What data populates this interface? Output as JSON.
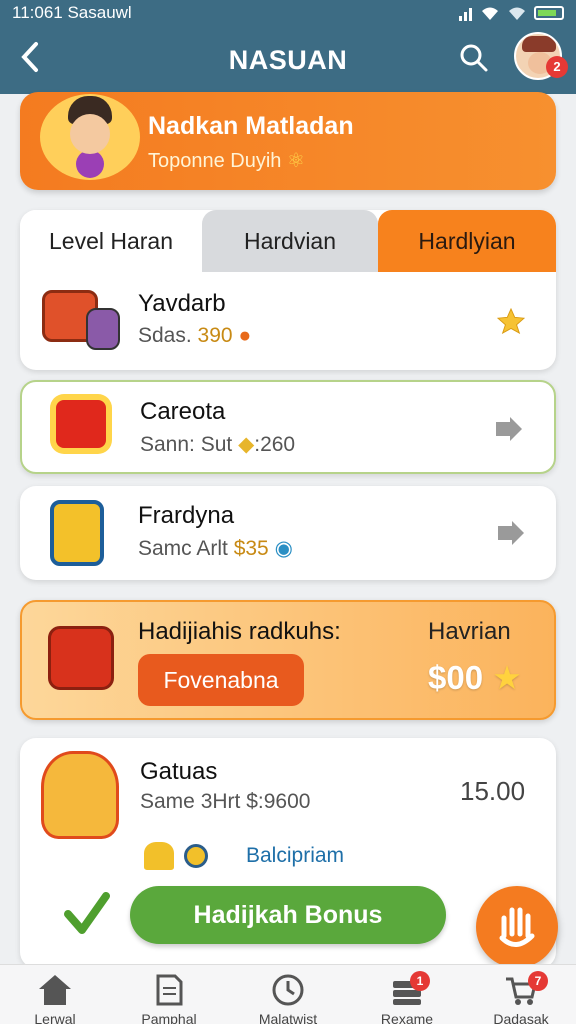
{
  "status": {
    "time": "11:061 Sasauwl"
  },
  "header": {
    "title": "NASUAN",
    "avatar_badge": "2"
  },
  "banner": {
    "title": "Nadkan Matladan",
    "subtitle": "Toponne Duyih"
  },
  "tabs": [
    {
      "label": "Level Haran",
      "state": "active"
    },
    {
      "label": "Hardvian",
      "state": "inactive"
    },
    {
      "label": "Hardlyian",
      "state": "highlighted"
    }
  ],
  "items": [
    {
      "name": "Yavdarb",
      "prefix": "Sdas.",
      "amount": "390",
      "action": "star-icon"
    },
    {
      "name": "Careota",
      "prefix": "Sann: Sut",
      "amount": ":260",
      "action": "share-arrow-icon"
    },
    {
      "name": "Frardyna",
      "prefix": "Samc Arlt",
      "amount": "$35",
      "action": "share-arrow-icon"
    }
  ],
  "promo": {
    "title": "Hadijiahis radkuhs:",
    "label": "Havrian",
    "button": "Fovenabna",
    "amount": "$00"
  },
  "bonus": {
    "name": "Gatuas",
    "sub": "Same 3Hrt $:9600",
    "value": "15.00",
    "tag": "Balcipriam",
    "button": "Hadijkah Bonus"
  },
  "nav": [
    {
      "label": "Lerwal",
      "icon": "home-icon",
      "badge": ""
    },
    {
      "label": "Pamphal",
      "icon": "document-icon",
      "badge": ""
    },
    {
      "label": "Malatwist",
      "icon": "clock-icon",
      "badge": ""
    },
    {
      "label": "Rexame",
      "icon": "stack-icon",
      "badge": "1"
    },
    {
      "label": "Dadasak",
      "icon": "cart-icon",
      "badge": "7"
    }
  ],
  "colors": {
    "header": "#3d6c84",
    "accent": "#f47b20",
    "green": "#5aa83c"
  }
}
